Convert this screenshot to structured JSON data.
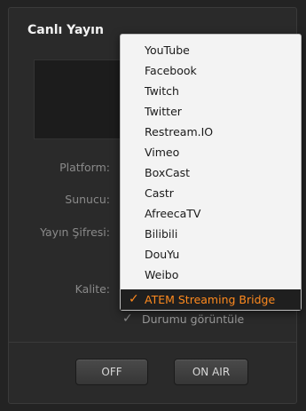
{
  "panel": {
    "title": "Canlı Yayın"
  },
  "fields": {
    "platform_label": "Platform:",
    "server_label": "Sunucu:",
    "stream_key_label": "Yayın Şifresi:",
    "quality_label": "Kalite:"
  },
  "show_status": {
    "label": "Durumu görüntüle",
    "checked": true
  },
  "buttons": {
    "off_label": "OFF",
    "on_air_label": "ON AIR"
  },
  "platform_menu": {
    "items": [
      "YouTube",
      "Facebook",
      "Twitch",
      "Twitter",
      "Restream.IO",
      "Vimeo",
      "BoxCast",
      "Castr",
      "AfreecaTV",
      "Bilibili",
      "DouYu",
      "Weibo",
      "ATEM Streaming Bridge"
    ],
    "selected": "ATEM Streaming Bridge",
    "accent_color": "#ff8a1e"
  }
}
